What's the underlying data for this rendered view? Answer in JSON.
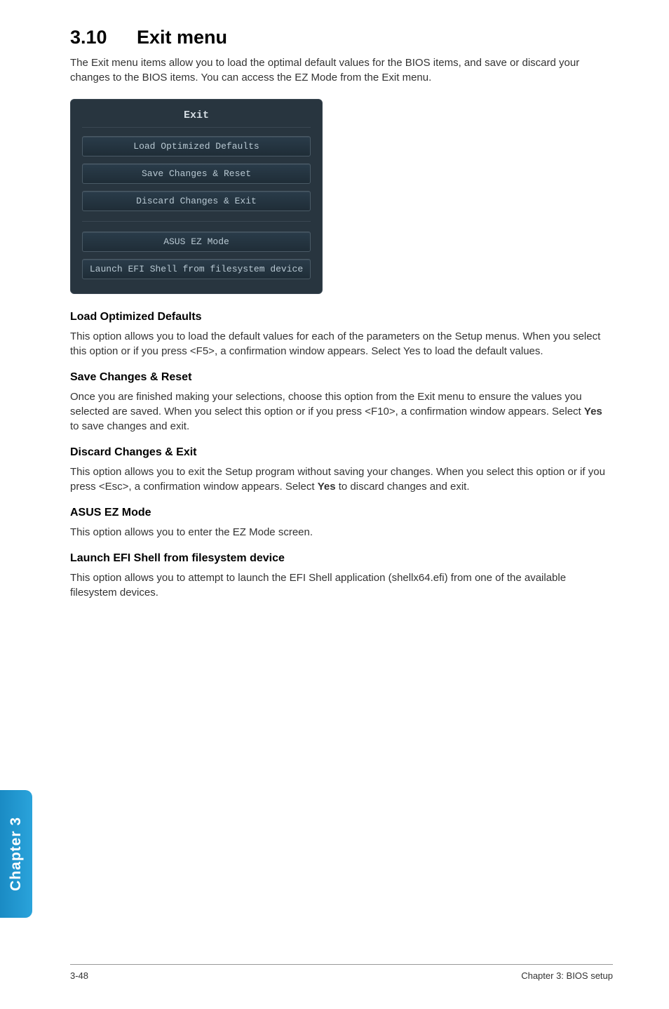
{
  "heading": {
    "number": "3.10",
    "title": "Exit menu"
  },
  "intro": "The Exit menu items allow you to load the optimal default values for the BIOS items, and save or discard your changes to the BIOS items. You can access the EZ Mode from the Exit menu.",
  "screenshot": {
    "title": "Exit",
    "group1": [
      "Load Optimized Defaults",
      "Save Changes & Reset",
      "Discard Changes & Exit"
    ],
    "group2": [
      "ASUS EZ Mode",
      "Launch EFI Shell from filesystem device"
    ]
  },
  "sections": [
    {
      "heading": "Load Optimized Defaults",
      "body": "This option allows you to load the default values for each of the parameters on the Setup menus. When you select this option or if you press <F5>, a confirmation window appears. Select Yes to load the default values."
    },
    {
      "heading": "Save Changes & Reset",
      "body_pre": "Once you are finished making your selections, choose this option from the Exit menu to ensure the values you selected are saved. When you select this option or if you press <F10>, a confirmation window appears. Select ",
      "body_bold": "Yes",
      "body_post": " to save changes and exit."
    },
    {
      "heading": "Discard Changes & Exit",
      "body_pre": "This option allows you to exit the Setup program without saving your changes. When you select this option or if you press <Esc>, a confirmation window appears. Select ",
      "body_bold": "Yes",
      "body_post": " to discard changes and exit."
    },
    {
      "heading": "ASUS EZ Mode",
      "body": "This option allows you to enter the EZ Mode screen."
    },
    {
      "heading": "Launch EFI Shell from filesystem device",
      "body": "This option allows you to attempt to launch the EFI Shell application (shellx64.efi) from one of the available filesystem devices."
    }
  ],
  "sidetab": "Chapter 3",
  "footer": {
    "left": "3-48",
    "right": "Chapter 3: BIOS setup"
  }
}
